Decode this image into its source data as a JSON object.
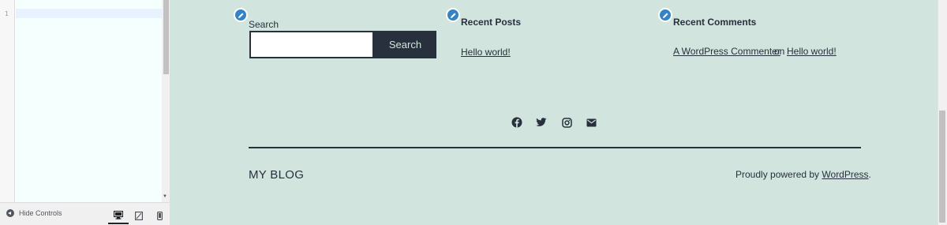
{
  "editor": {
    "line_numbers": [
      "1"
    ]
  },
  "controls": {
    "hide_label": "Hide Controls",
    "devices": [
      "desktop-icon",
      "tablet-icon",
      "mobile-icon"
    ]
  },
  "widgets": {
    "search": {
      "label": "Search",
      "input_value": "",
      "button_label": "Search"
    },
    "recent_posts": {
      "title": "Recent Posts",
      "items": [
        "Hello world!"
      ]
    },
    "recent_comments": {
      "title": "Recent Comments",
      "author": "A WordPress Commenter",
      "connector": "on",
      "post": "Hello world!"
    }
  },
  "social_icons": [
    "facebook-icon",
    "twitter-icon",
    "instagram-icon",
    "email-icon"
  ],
  "footer": {
    "site_title": "MY BLOG",
    "powered_text": "Proudly powered by",
    "powered_link": "WordPress",
    "powered_suffix": "."
  },
  "colors": {
    "preview_background": "#d1e4dd",
    "text": "#28303d",
    "edit_shortcut": "#3582c4"
  }
}
